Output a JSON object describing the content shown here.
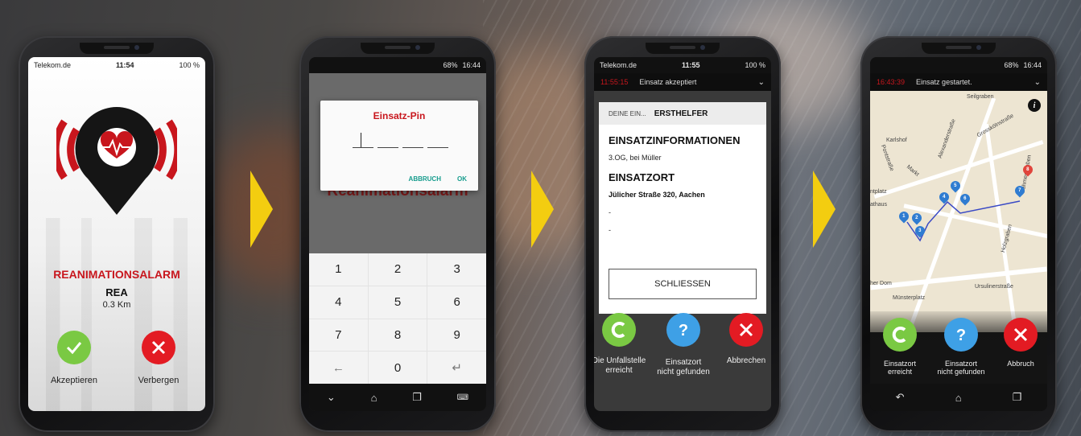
{
  "phone1": {
    "status": {
      "carrier": "Telekom.de",
      "time": "11:54",
      "battery": "100 %"
    },
    "title": "REANIMATIONSALARM",
    "code": "REA",
    "distance": "0.3 Km",
    "accept_label": "Akzeptieren",
    "decline_label": "Verbergen",
    "colors": {
      "accent": "#c8161d",
      "accept": "#7ac943",
      "decline": "#e31b23"
    }
  },
  "phone2": {
    "status": {
      "signal": "68%",
      "time": "16:44"
    },
    "background_title": "Reanimationsalarm",
    "dialog_title": "Einsatz-Pin",
    "cancel_label": "ABBRUCH",
    "ok_label": "OK",
    "keys": [
      "1",
      "2",
      "3",
      "4",
      "5",
      "6",
      "7",
      "8",
      "9",
      "←",
      "0",
      "↵"
    ]
  },
  "phone3": {
    "status": {
      "carrier": "Telekom.de",
      "time": "11:55",
      "battery": "100 %"
    },
    "header_time": "11:55:15",
    "header_text": "Einsatz akzeptiert",
    "tab_inactive": "DEINE EIN...",
    "tab_active": "ERSTHELFER",
    "section1_heading": "EINSATZINFORMATIONEN",
    "section1_text": "3.OG, bei Müller",
    "section2_heading": "EINSATZORT",
    "address": "Jülicher Straße 320, Aachen",
    "dash1": "-",
    "dash2": "-",
    "close_label": "SCHLIESSEN",
    "actions": [
      {
        "label_line1": "Die Unfallstelle",
        "label_line2": "erreicht"
      },
      {
        "label_line1": "Einsatzort",
        "label_line2": "nicht gefunden"
      },
      {
        "label_line1": "Abbrechen",
        "label_line2": ""
      }
    ]
  },
  "phone4": {
    "status": {
      "signal": "68%",
      "time": "16:44"
    },
    "header_time": "16:43:39",
    "header_text": "Einsatz gestartet.",
    "map_labels": [
      "Karlshof",
      "Grosskölnstraße",
      "Pontstraße",
      "Markt",
      "ntplatz",
      "athaus",
      "her Dom",
      "Münsterplatz",
      "Ursulinerstraße",
      "Dahmengraben",
      "Holzgraben",
      "Seilgraben",
      "Alexanderstraße"
    ],
    "pins": [
      "1",
      "2",
      "3",
      "4",
      "5",
      "6",
      "7",
      "8"
    ],
    "actions": [
      {
        "label_line1": "Einsatzort",
        "label_line2": "erreicht"
      },
      {
        "label_line1": "Einsatzort",
        "label_line2": "nicht gefunden"
      },
      {
        "label_line1": "Abbruch",
        "label_line2": ""
      }
    ]
  }
}
